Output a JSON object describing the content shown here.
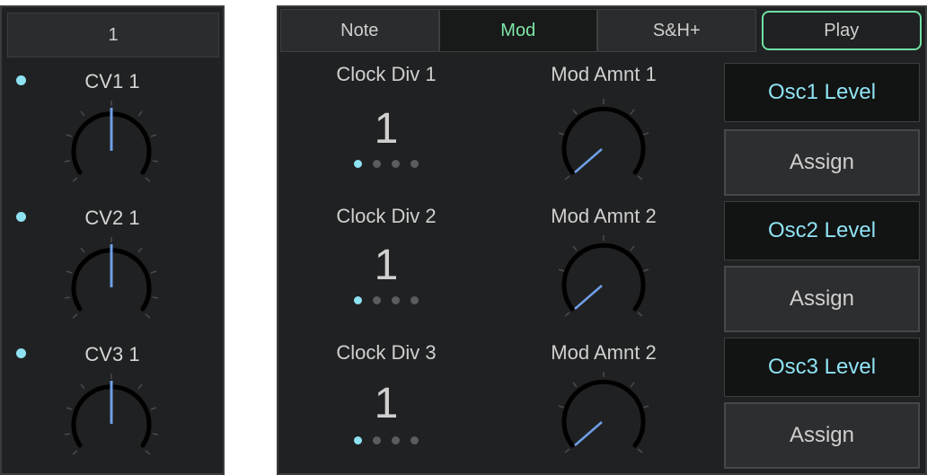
{
  "left": {
    "header": "1",
    "knobs": [
      {
        "label": "CV1 1"
      },
      {
        "label": "CV2 1"
      },
      {
        "label": "CV3 1"
      }
    ]
  },
  "tabs": [
    "Note",
    "Mod",
    "S&H+",
    "Play"
  ],
  "active_tab": "Mod",
  "rows": [
    {
      "clock_label": "Clock Div 1",
      "clock_value": "1",
      "mod_label": "Mod Amnt 1",
      "target": "Osc1 Level",
      "assign": "Assign"
    },
    {
      "clock_label": "Clock Div 2",
      "clock_value": "1",
      "mod_label": "Mod Amnt 2",
      "target": "Osc2 Level",
      "assign": "Assign"
    },
    {
      "clock_label": "Clock Div 3",
      "clock_value": "1",
      "mod_label": "Mod Amnt 2",
      "target": "Osc3 Level",
      "assign": "Assign"
    }
  ],
  "colors": {
    "accent_cyan": "#8ee2f2",
    "accent_green": "#6fe0a3",
    "knob_needle_cv": "#6f9fe8",
    "panel_bg": "#202122"
  }
}
